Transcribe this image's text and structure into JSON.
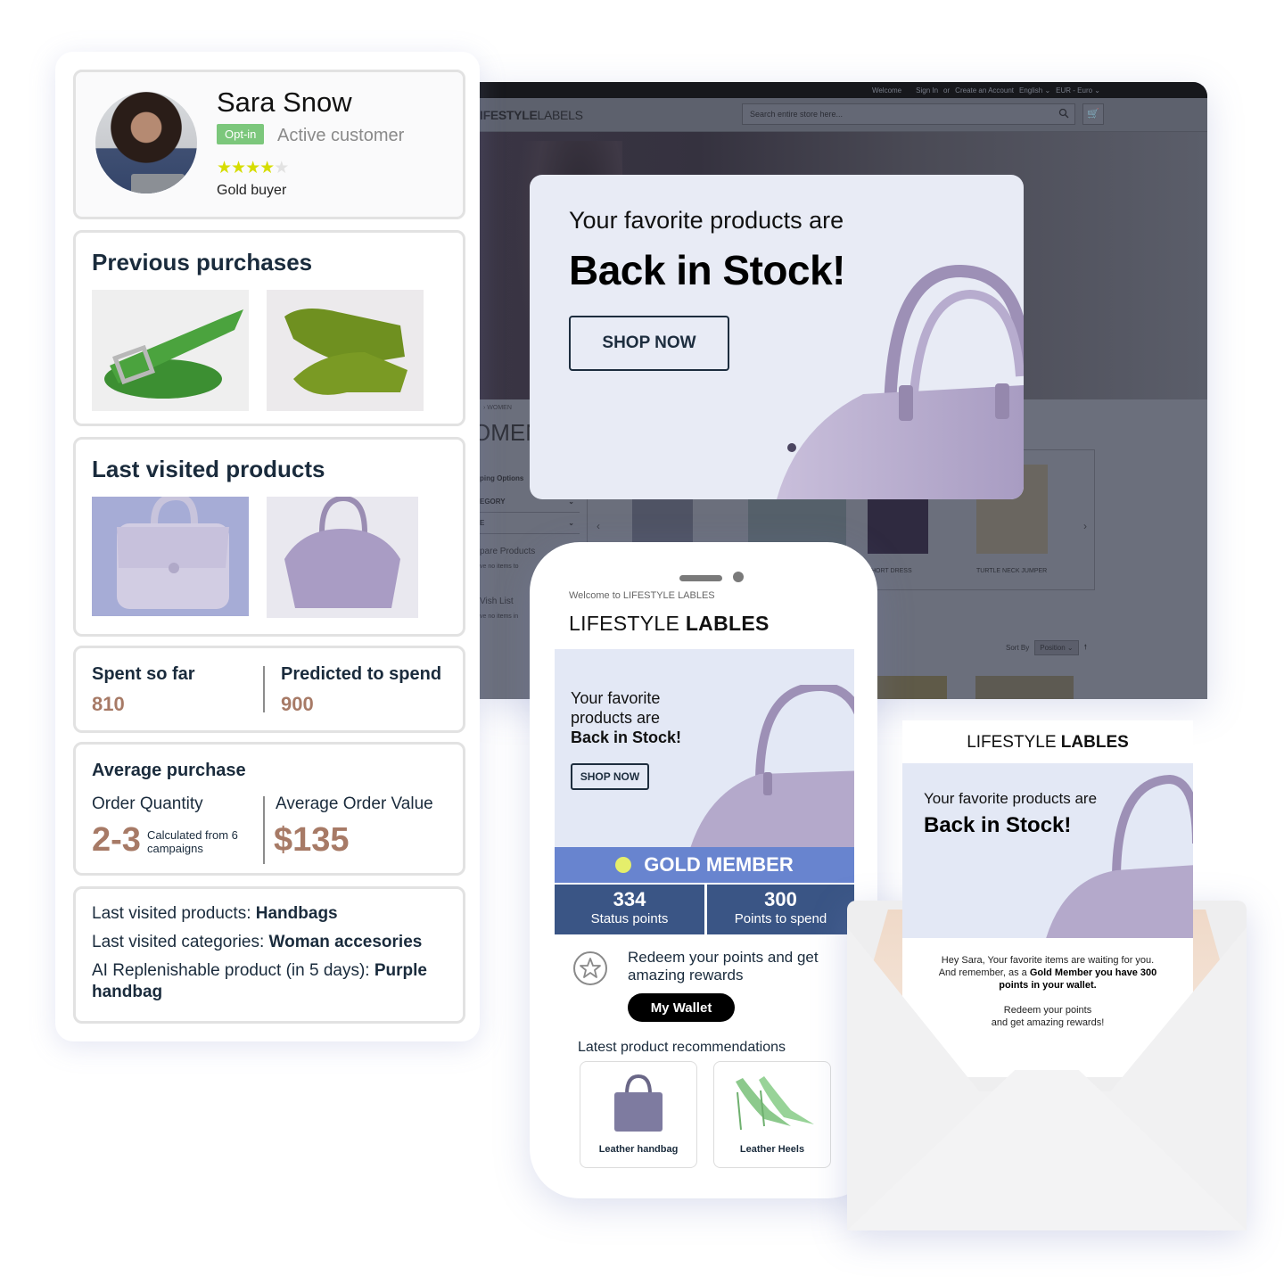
{
  "website": {
    "topbar": {
      "welcome": "Welcome",
      "sign_in": "Sign In",
      "or": "or",
      "create_account": "Create an Account",
      "language": "English ⌄",
      "currency": "EUR - Euro ⌄"
    },
    "logo_bold": "IFESTYLE",
    "logo_light": "LABELS",
    "search_placeholder": "Search entire store here...",
    "breadcrumb": "›  WOMEN",
    "page_title": "OMEN",
    "sidebar": {
      "heading": "ping Options",
      "filters": [
        "EGORY",
        "E"
      ],
      "compare": "pare Products",
      "compare_note": "ve no items to",
      "wishlist": "Vish List",
      "wishlist_note": "ve no items in"
    },
    "carousel_labels": [
      "HORT DRESS",
      "TURTLE NECK JUMPER"
    ],
    "sort_label": "Sort By",
    "sort_value": "Position ⌄"
  },
  "banner": {
    "subtitle": "Your favorite products are",
    "headline": "Back in Stock!",
    "cta": "SHOP NOW"
  },
  "profile": {
    "name": "Sara Snow",
    "optin_badge": "Opt-in",
    "status": "Active customer",
    "rating": 4,
    "rating_max": 5,
    "tier": "Gold buyer",
    "colors": {
      "optin": "#7cc77c",
      "star_on": "#d6dd00",
      "star_off": "#e2e2e2"
    }
  },
  "previous_purchases": {
    "title": "Previous purchases",
    "items": [
      "green-belt",
      "green-gloves"
    ]
  },
  "last_visited": {
    "title": "Last visited products",
    "items": [
      "lavender-satchel",
      "purple-handbag"
    ]
  },
  "spend": {
    "spent_label": "Spent so far",
    "spent_value": "810",
    "predicted_label": "Predicted to spend",
    "predicted_value": "900",
    "value_color": "#a77a66"
  },
  "average_purchase": {
    "title": "Average purchase",
    "qty_label": "Order Quantity",
    "qty_value": "2-3",
    "qty_note": "Calculated from 6 campaigns",
    "aov_label": "Average Order Value",
    "aov_value": "$135"
  },
  "facts": [
    {
      "label": "Last visited products: ",
      "value": "Handbags"
    },
    {
      "label": "Last visited categories: ",
      "value": "Woman accesories"
    },
    {
      "label": "AI Replenishable product (in 5 days): ",
      "value": "Purple handbag"
    }
  ],
  "phone": {
    "welcome": "Welcome to LIFESTYLE LABLES",
    "logo_light": "LIFESTYLE ",
    "logo_bold": "LABLES",
    "hero_line1": "Your favorite",
    "hero_line2": "products are",
    "hero_bold": "Back in Stock!",
    "hero_cta": "SHOP NOW",
    "member_tier": "GOLD MEMBER",
    "status_points": "334",
    "status_points_label": "Status points",
    "spend_points": "300",
    "spend_points_label": "Points to spend",
    "redeem_text": "Redeem your points and get amazing rewards",
    "wallet_button": "My Wallet",
    "recommendations_title": "Latest product recommendations",
    "recommendations": [
      "Leather handbag",
      "Leather Heels"
    ],
    "colors": {
      "gold_bar": "#6884cf",
      "points_bar": "#3a5585",
      "gold_dot": "#e5ee6b"
    }
  },
  "email": {
    "logo_light": "LIFESTYLE ",
    "logo_bold": "LABLES",
    "subtitle": "Your favorite products are",
    "headline": "Back in Stock!",
    "body_line1": "Hey Sara, Your favorite items are waiting for you.",
    "body_line2_pre": "And remember, as a ",
    "body_line2_bold": "Gold Member you have 300 points in your wallet.",
    "body_line3": "Redeem your points",
    "body_line4": "and get amazing rewards!"
  }
}
